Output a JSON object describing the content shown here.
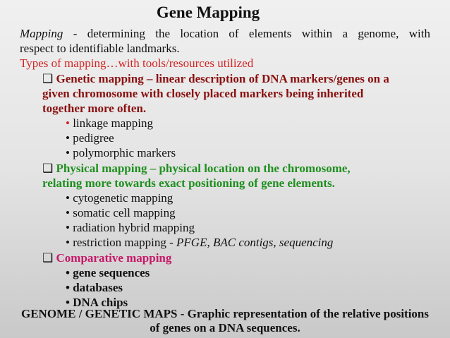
{
  "title": "Gene Mapping",
  "definition": {
    "term": "Mapping",
    "text": " - determining the location of elements within a genome, with",
    "line2": "respect to identifiable landmarks."
  },
  "types_heading": "Types of mapping…with tools/resources utilized",
  "genetic": {
    "label": "Genetic mapping – linear description of DNA markers/genes on a",
    "line2": "given chromosome with closely placed markers being inherited",
    "line3": "together more often.",
    "items": [
      "linkage mapping",
      "pedigree",
      "polymorphic markers"
    ]
  },
  "physical": {
    "label": "Physical mapping – physical location on the chromosome,",
    "line2": "relating more towards exact positioning of gene elements.",
    "items": [
      "cytogenetic mapping",
      "somatic cell mapping",
      "radiation hybrid mapping",
      "restriction mapping - "
    ],
    "restriction_tools": "PFGE, BAC contigs, sequencing"
  },
  "comparative": {
    "label": "Comparative mapping",
    "items": [
      "gene sequences",
      "databases",
      "DNA chips"
    ]
  },
  "footer": {
    "line1": "GENOME / GENETIC MAPS - Graphic representation of the relative positions",
    "line2": "of genes on a DNA sequences."
  },
  "colors": {
    "red": "#d42424",
    "genetic": "#8a0f0f",
    "physical": "#1f8f1f",
    "comparative": "#c81868"
  }
}
